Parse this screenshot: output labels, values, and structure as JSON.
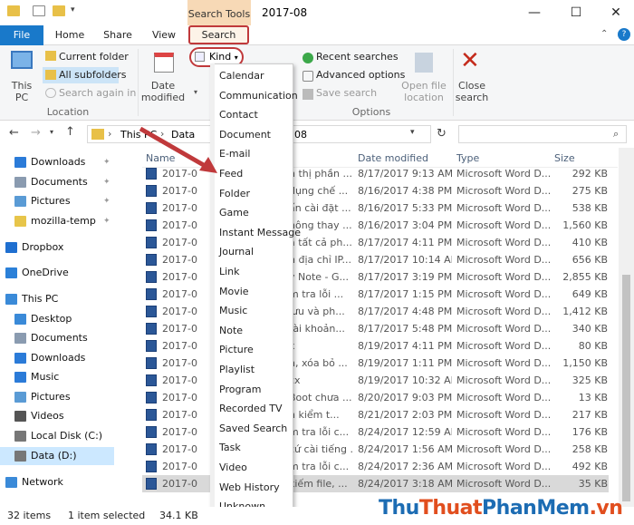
{
  "window": {
    "title": "2017-08",
    "context_tab": "Search Tools"
  },
  "tabs": [
    "File",
    "Home",
    "Share",
    "View",
    "Search"
  ],
  "ribbon": {
    "this_pc": "This\nPC",
    "current_folder": "Current folder",
    "all_subfolders": "All subfolders",
    "search_again_in": "Search again in",
    "location_group": "Location",
    "date_modified": "Date\nmodified",
    "kind": "Kind",
    "recent_searches": "Recent searches",
    "advanced_options": "Advanced options",
    "save_search": "Save search",
    "options_group": "Options",
    "open_file_location": "Open file\nlocation",
    "close_search": "Close\nsearch"
  },
  "address": {
    "parts": [
      "This PC",
      "Data",
      "08"
    ]
  },
  "columns": {
    "name": "Name",
    "date": "Date modified",
    "type": "Type",
    "size": "Size"
  },
  "nav": [
    {
      "label": "Downloads",
      "pinned": true,
      "color": "#2b7bd8"
    },
    {
      "label": "Documents",
      "pinned": true,
      "color": "#8a9bb0"
    },
    {
      "label": "Pictures",
      "pinned": true,
      "color": "#5a9bd5"
    },
    {
      "label": "mozilla-temp",
      "pinned": true,
      "color": "#e7c54a"
    },
    {
      "label": "Dropbox",
      "pinned": false,
      "color": "#1f6fd0"
    },
    {
      "label": "OneDrive",
      "pinned": false,
      "color": "#2b80d8"
    },
    {
      "label": "This PC",
      "pinned": false,
      "color": "#3a8ad8"
    },
    {
      "label": "Desktop",
      "pinned": false,
      "color": "#3a8ad8"
    },
    {
      "label": "Documents",
      "pinned": false,
      "color": "#8a9bb0"
    },
    {
      "label": "Downloads",
      "pinned": false,
      "color": "#2b7bd8"
    },
    {
      "label": "Music",
      "pinned": false,
      "color": "#2b7bd8"
    },
    {
      "label": "Pictures",
      "pinned": false,
      "color": "#5a9bd5"
    },
    {
      "label": "Videos",
      "pinned": false,
      "color": "#555555"
    },
    {
      "label": "Local Disk (C:)",
      "pinned": false,
      "color": "#777777"
    },
    {
      "label": "Data (D:)",
      "pinned": false,
      "color": "#777777"
    },
    {
      "label": "Network",
      "pinned": false,
      "color": "#3a8ad8"
    }
  ],
  "files": [
    {
      "name": "2017-0",
      "tail": "n thị phần ...",
      "date": "8/17/2017 9:13 AM",
      "type": "Microsoft Word D...",
      "size": "292 KB"
    },
    {
      "name": "2017-0",
      "tail": "dụng chế ...",
      "date": "8/16/2017 4:38 PM",
      "type": "Microsoft Word D...",
      "size": "275 KB"
    },
    {
      "name": "2017-0",
      "tail": "ấn cài đặt ...",
      "date": "8/16/2017 5:33 PM",
      "type": "Microsoft Word D...",
      "size": "538 KB"
    },
    {
      "name": "2017-0",
      "tail": "hông thay ...",
      "date": "8/16/2017 3:04 PM",
      "type": "Microsoft Word D...",
      "size": "1,560 KB"
    },
    {
      "name": "2017-0",
      "tail": "a tất cả ph...",
      "date": "8/17/2017 4:11 PM",
      "type": "Microsoft Word D...",
      "size": "410 KB"
    },
    {
      "name": "2017-0",
      "tail": "n địa chỉ IP...",
      "date": "8/17/2017 10:14 AM",
      "type": "Microsoft Word D...",
      "size": "656 KB"
    },
    {
      "name": "2017-0",
      "tail": "y Note - G...",
      "date": "8/17/2017 3:19 PM",
      "type": "Microsoft Word D...",
      "size": "2,855 KB"
    },
    {
      "name": "2017-0",
      "tail": "m tra lỗi ...",
      "date": "8/17/2017 1:15 PM",
      "type": "Microsoft Word D...",
      "size": "649 KB"
    },
    {
      "name": "2017-0",
      "tail": "lưu và ph...",
      "date": "8/17/2017 4:48 PM",
      "type": "Microsoft Word D...",
      "size": "1,412 KB"
    },
    {
      "name": "2017-0",
      "tail": "tài khoản...",
      "date": "8/17/2017 5:48 PM",
      "type": "Microsoft Word D...",
      "size": "340 KB"
    },
    {
      "name": "2017-0",
      "tail": "x",
      "date": "8/19/2017 4:11 PM",
      "type": "Microsoft Word D...",
      "size": "80 KB"
    },
    {
      "name": "2017-0",
      "tail": "n, xóa bỏ ...",
      "date": "8/19/2017 1:11 PM",
      "type": "Microsoft Word D...",
      "size": "1,150 KB"
    },
    {
      "name": "2017-0",
      "tail": "cx",
      "date": "8/19/2017 10:32 AM",
      "type": "Microsoft Word D...",
      "size": "325 KB"
    },
    {
      "name": "2017-0",
      "tail": "Boot chưa ...",
      "date": "8/20/2017 9:03 PM",
      "type": "Microsoft Word D...",
      "size": "13 KB"
    },
    {
      "name": "2017-0",
      "tail": "n kiểm t...",
      "date": "8/21/2017 2:03 PM",
      "type": "Microsoft Word D...",
      "size": "217 KB"
    },
    {
      "name": "2017-0",
      "tail": "m tra lỗi c...",
      "date": "8/24/2017 12:59 AM",
      "type": "Microsoft Word D...",
      "size": "176 KB"
    },
    {
      "name": "2017-0",
      "tail": "cứ cài tiếng ...",
      "date": "8/24/2017 1:56 AM",
      "type": "Microsoft Word D...",
      "size": "258 KB"
    },
    {
      "name": "2017-0",
      "tail": "m tra lỗi c...",
      "date": "8/24/2017 2:36 AM",
      "type": "Microsoft Word D...",
      "size": "492 KB"
    },
    {
      "name": "2017-0",
      "tail": "kiếm file, ...",
      "date": "8/24/2017 3:18 AM",
      "type": "Microsoft Word D...",
      "size": "35 KB"
    }
  ],
  "kind_menu": [
    "Calendar",
    "Communication",
    "Contact",
    "Document",
    "E-mail",
    "Feed",
    "Folder",
    "Game",
    "Instant Message",
    "Journal",
    "Link",
    "Movie",
    "Music",
    "Note",
    "Picture",
    "Playlist",
    "Program",
    "Recorded TV",
    "Saved Search",
    "Task",
    "Video",
    "Web History",
    "Unknown"
  ],
  "status": {
    "items": "32 items",
    "selected": "1 item selected",
    "size": "34.1 KB"
  },
  "watermark": {
    "a": "Thu",
    "b": "Thuat",
    "c": "PhanMem",
    "d": ".vn"
  },
  "colors": {
    "accent": "#1979ca",
    "highlight": "#c0393b",
    "context_tab": "#f7d9b6"
  }
}
